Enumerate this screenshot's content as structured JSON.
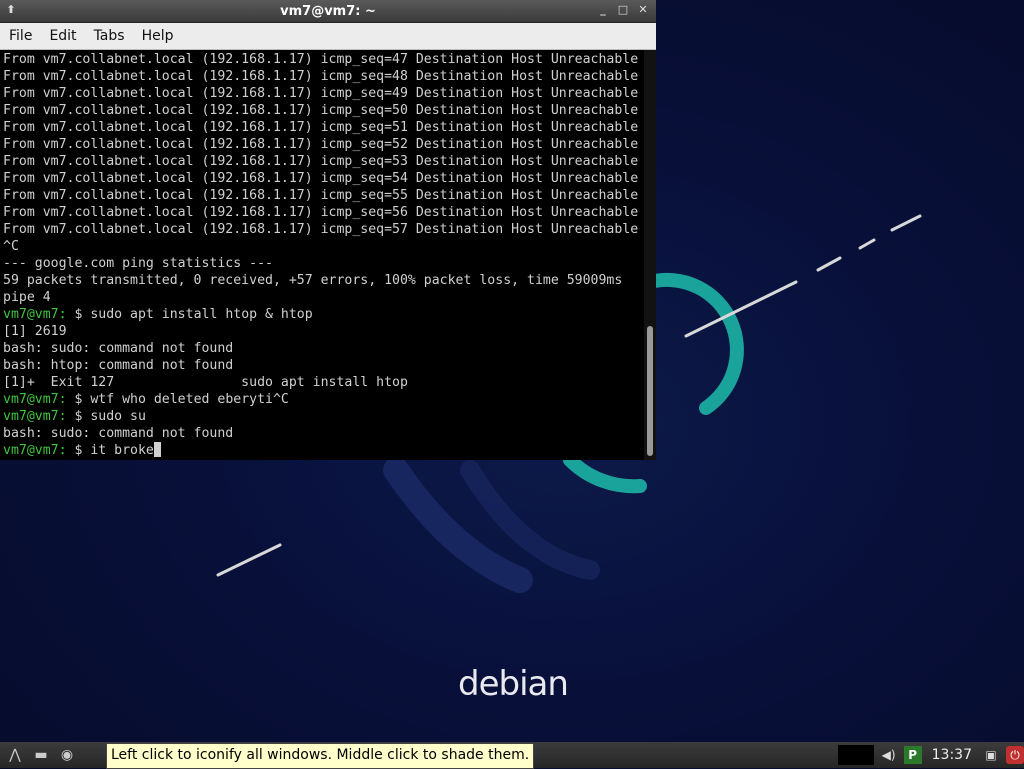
{
  "window": {
    "title": "vm7@vm7: ~",
    "menu": [
      "File",
      "Edit",
      "Tabs",
      "Help"
    ]
  },
  "terminal": {
    "lines": [
      {
        "text": "From vm7.collabnet.local (192.168.1.17) icmp_seq=47 Destination Host Unreachable"
      },
      {
        "text": "From vm7.collabnet.local (192.168.1.17) icmp_seq=48 Destination Host Unreachable"
      },
      {
        "text": "From vm7.collabnet.local (192.168.1.17) icmp_seq=49 Destination Host Unreachable"
      },
      {
        "text": "From vm7.collabnet.local (192.168.1.17) icmp_seq=50 Destination Host Unreachable"
      },
      {
        "text": "From vm7.collabnet.local (192.168.1.17) icmp_seq=51 Destination Host Unreachable"
      },
      {
        "text": "From vm7.collabnet.local (192.168.1.17) icmp_seq=52 Destination Host Unreachable"
      },
      {
        "text": "From vm7.collabnet.local (192.168.1.17) icmp_seq=53 Destination Host Unreachable"
      },
      {
        "text": "From vm7.collabnet.local (192.168.1.17) icmp_seq=54 Destination Host Unreachable"
      },
      {
        "text": "From vm7.collabnet.local (192.168.1.17) icmp_seq=55 Destination Host Unreachable"
      },
      {
        "text": "From vm7.collabnet.local (192.168.1.17) icmp_seq=56 Destination Host Unreachable"
      },
      {
        "text": "From vm7.collabnet.local (192.168.1.17) icmp_seq=57 Destination Host Unreachable"
      },
      {
        "text": "^C"
      },
      {
        "text": "--- google.com ping statistics ---"
      },
      {
        "text": "59 packets transmitted, 0 received, +57 errors, 100% packet loss, time 59009ms"
      },
      {
        "text": "pipe 4"
      },
      {
        "prompt": "vm7@vm7:",
        "text": " $ sudo apt install htop & htop"
      },
      {
        "text": "[1] 2619"
      },
      {
        "text": "bash: sudo: command not found"
      },
      {
        "text": "bash: htop: command not found"
      },
      {
        "text": "[1]+  Exit 127                sudo apt install htop"
      },
      {
        "prompt": "vm7@vm7:",
        "text": " $ wtf who deleted eberyti^C"
      },
      {
        "prompt": "vm7@vm7:",
        "text": " $ sudo su"
      },
      {
        "text": "bash: sudo: command not found"
      },
      {
        "prompt": "vm7@vm7:",
        "text": " $ it broke",
        "cursor": true
      }
    ]
  },
  "desktop": {
    "logo_text": "debian"
  },
  "taskbar": {
    "tooltip": "Left click to iconify all windows.  Middle click to shade them.",
    "clock": "13:37"
  },
  "colors": {
    "prompt": "#3fc43f",
    "terminal_bg": "#000000",
    "desktop_bg": "#08103a",
    "accent_teal": "#1aa39a"
  }
}
